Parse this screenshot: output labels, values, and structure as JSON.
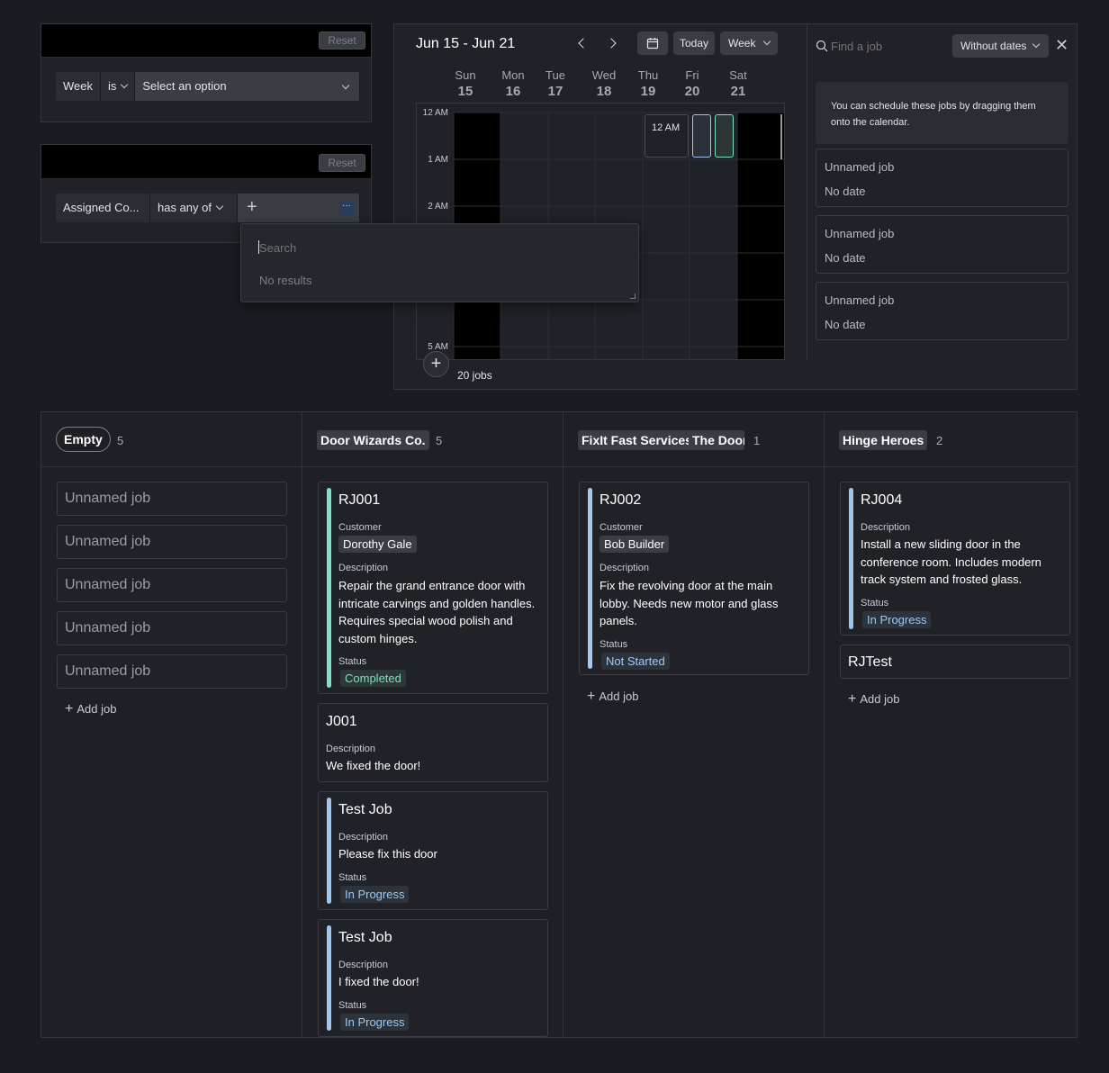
{
  "filter1": {
    "reset": "Reset",
    "field": "Week",
    "op": "is",
    "value": "Select an option"
  },
  "filter2": {
    "reset": "Reset",
    "field": "Assigned Co...",
    "op": "has any of",
    "more": "···"
  },
  "dropdown": {
    "placeholder": "Search",
    "empty": "No results"
  },
  "calendar": {
    "range": "Jun 15 - Jun 21",
    "today": "Today",
    "view": "Week",
    "days": [
      {
        "n": "Sun",
        "d": "15"
      },
      {
        "n": "Mon",
        "d": "16"
      },
      {
        "n": "Tue",
        "d": "17"
      },
      {
        "n": "Wed",
        "d": "18"
      },
      {
        "n": "Thu",
        "d": "19"
      },
      {
        "n": "Fri",
        "d": "20"
      },
      {
        "n": "Sat",
        "d": "21"
      }
    ],
    "hours": [
      "12 AM",
      "1 AM",
      "2 AM",
      "5 AM"
    ],
    "event_label": "12 AM",
    "jobs_count": "20 jobs"
  },
  "sidebar": {
    "search_placeholder": "Find a job",
    "filter": "Without dates",
    "hint": "You can schedule these jobs by dragging them onto the calendar.",
    "items": [
      {
        "title": "Unnamed job",
        "date": "No date"
      },
      {
        "title": "Unnamed job",
        "date": "No date"
      },
      {
        "title": "Unnamed job",
        "date": "No date"
      }
    ]
  },
  "board": {
    "add_job": "Add job",
    "labels": {
      "customer": "Customer",
      "description": "Description",
      "status": "Status"
    },
    "empty": {
      "name": "Empty",
      "count": "5",
      "items": [
        "Unnamed job",
        "Unnamed job",
        "Unnamed job",
        "Unnamed job",
        "Unnamed job"
      ]
    },
    "door_wizards": {
      "name": "Door Wizards Co.",
      "count": "5",
      "cards": [
        {
          "id": "RJ001",
          "customer": "Dorothy Gale",
          "description": "Repair the grand entrance door with intricate carvings and golden handles. Requires special wood polish and custom hinges.",
          "status": "Completed"
        },
        {
          "id": "J001",
          "description": "We fixed the door!"
        },
        {
          "id": "Test Job",
          "description": "Please fix this door",
          "status": "In Progress"
        },
        {
          "id": "Test Job",
          "description": "I fixed the door!",
          "status": "In Progress"
        }
      ]
    },
    "fixit": {
      "name": "FixIt Fast Services",
      "name2": "The Door",
      "count": "1",
      "cards": [
        {
          "id": "RJ002",
          "customer": "Bob Builder",
          "description": "Fix the revolving door at the main lobby. Needs new motor and glass panels.",
          "status": "Not Started"
        }
      ]
    },
    "hinge": {
      "name": "Hinge Heroes",
      "count": "2",
      "cards": [
        {
          "id": "RJ004",
          "description": "Install a new sliding door in the conference room. Includes modern track system and frosted glass.",
          "status": "In Progress"
        },
        {
          "id": "RJTest"
        }
      ]
    }
  },
  "colors": {
    "completed": "#7de0c3",
    "in_progress": "#9cc8f5",
    "not_started": "#a8c8f0",
    "bar_blue": "#9fc6ee",
    "bar_teal": "#7ee0c7"
  }
}
